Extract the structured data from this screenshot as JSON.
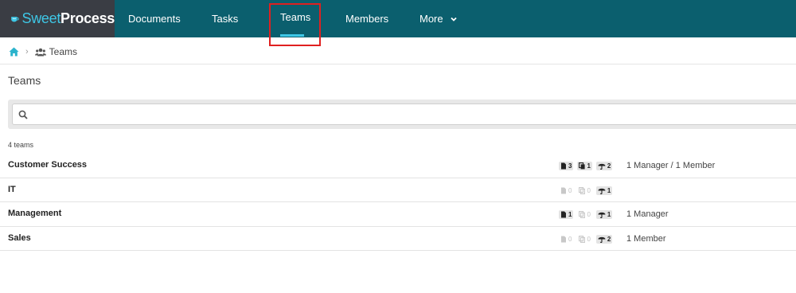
{
  "app": {
    "logo_sweet": "Sweet",
    "logo_process": "Process"
  },
  "nav": {
    "documents": "Documents",
    "tasks": "Tasks",
    "teams": "Teams",
    "members": "Members",
    "more": "More",
    "active": "Teams"
  },
  "breadcrumb": {
    "current": "Teams"
  },
  "page": {
    "title": "Teams"
  },
  "search": {
    "value": "",
    "placeholder": ""
  },
  "list": {
    "count_label": "4 teams",
    "teams": [
      {
        "name": "Customer Success",
        "documents": "3",
        "processes": "1",
        "policies": "2",
        "members": "1 Manager / 1 Member"
      },
      {
        "name": "IT",
        "documents": "0",
        "processes": "0",
        "policies": "1",
        "members": ""
      },
      {
        "name": "Management",
        "documents": "1",
        "processes": "0",
        "policies": "1",
        "members": "1 Manager"
      },
      {
        "name": "Sales",
        "documents": "0",
        "processes": "0",
        "policies": "2",
        "members": "1 Member"
      }
    ]
  },
  "colors": {
    "topbar": "#0b5f6e",
    "logo_bg": "#3a3d44",
    "accent": "#3ec7e6",
    "highlight": "#e02020"
  },
  "icons": {
    "logo": "teacup-logo-icon",
    "home": "home-icon",
    "team": "users-icon",
    "search": "search-icon",
    "documents": "document-icon",
    "processes": "copy-icon",
    "policies": "umbrella-icon"
  }
}
